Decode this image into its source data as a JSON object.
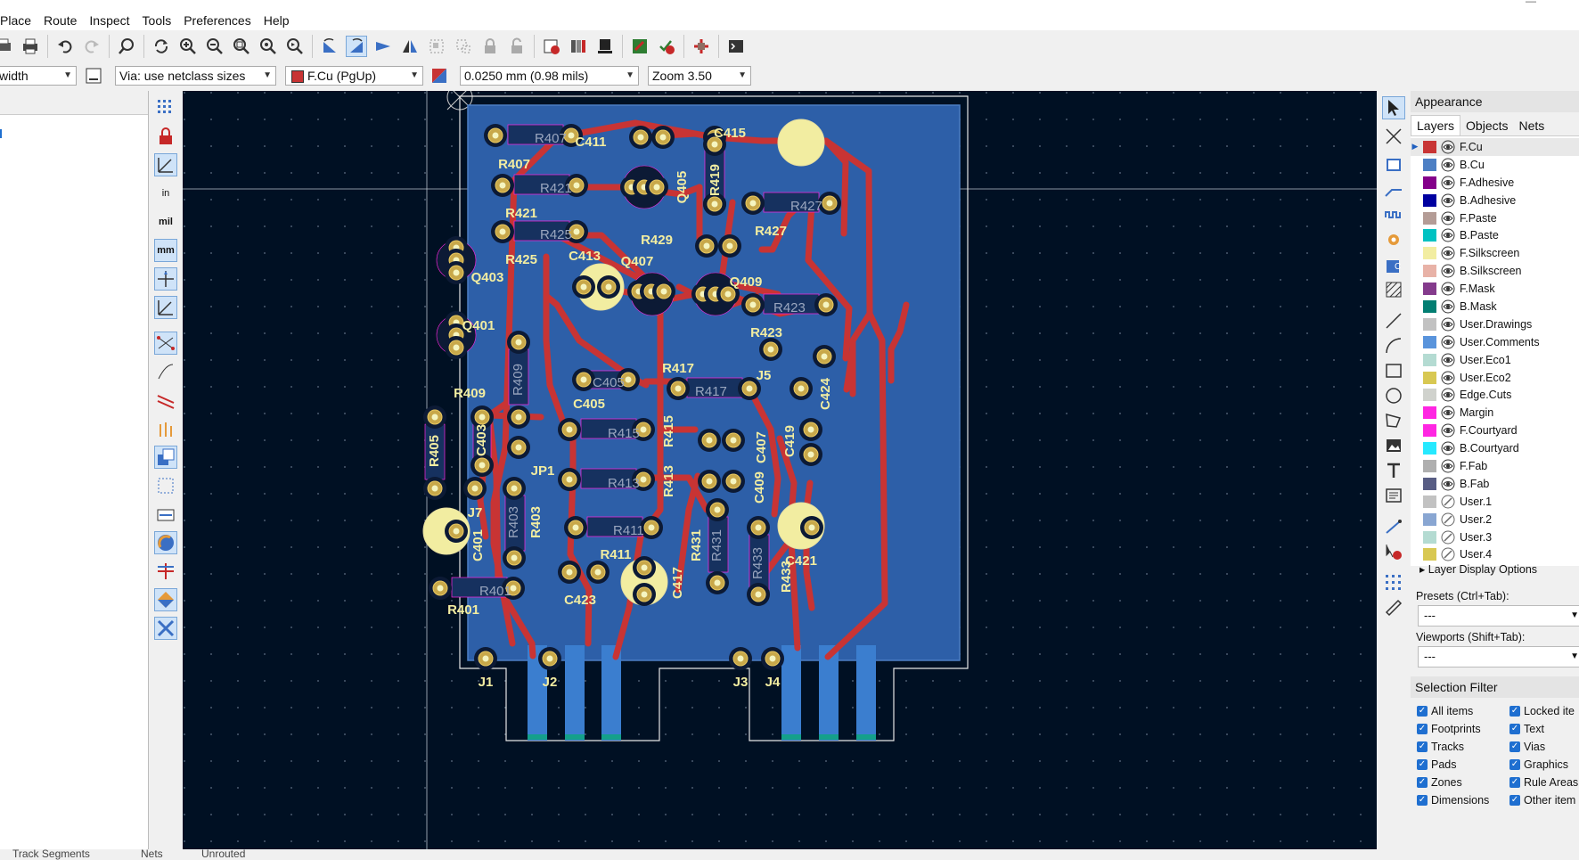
{
  "menu": [
    "Place",
    "Route",
    "Inspect",
    "Tools",
    "Preferences",
    "Help"
  ],
  "toolbar2": {
    "track_width": "width",
    "via_size": "Via: use netclass sizes",
    "layer": "F.Cu (PgUp)",
    "grid": "0.0250 mm (0.98 mils)",
    "zoom": "Zoom 3.50"
  },
  "units_buttons": {
    "inches": "in",
    "mils": "mil",
    "mm": "mm"
  },
  "appearance": {
    "title": "Appearance",
    "tabs": [
      "Layers",
      "Objects",
      "Nets"
    ],
    "layers": [
      {
        "name": "F.Cu",
        "color": "#c83434",
        "visible": true
      },
      {
        "name": "B.Cu",
        "color": "#4d7fc4",
        "visible": true
      },
      {
        "name": "F.Adhesive",
        "color": "#84008a",
        "visible": true
      },
      {
        "name": "B.Adhesive",
        "color": "#0000a0",
        "visible": true
      },
      {
        "name": "F.Paste",
        "color": "#b49c96",
        "visible": true
      },
      {
        "name": "B.Paste",
        "color": "#00c2c2",
        "visible": true
      },
      {
        "name": "F.Silkscreen",
        "color": "#f2eda1",
        "visible": true
      },
      {
        "name": "B.Silkscreen",
        "color": "#e8b2a7",
        "visible": true
      },
      {
        "name": "F.Mask",
        "color": "#843b8c",
        "visible": true
      },
      {
        "name": "B.Mask",
        "color": "#027e72",
        "visible": true
      },
      {
        "name": "User.Drawings",
        "color": "#c2c2c2",
        "visible": true
      },
      {
        "name": "User.Comments",
        "color": "#5994dc",
        "visible": true
      },
      {
        "name": "User.Eco1",
        "color": "#b4dbd2",
        "visible": true
      },
      {
        "name": "User.Eco2",
        "color": "#d8c852",
        "visible": true
      },
      {
        "name": "Edge.Cuts",
        "color": "#d0d2cd",
        "visible": true
      },
      {
        "name": "Margin",
        "color": "#ff26e2",
        "visible": true
      },
      {
        "name": "F.Courtyard",
        "color": "#ff26e2",
        "visible": true
      },
      {
        "name": "B.Courtyard",
        "color": "#26e9ff",
        "visible": true
      },
      {
        "name": "F.Fab",
        "color": "#afafaf",
        "visible": true
      },
      {
        "name": "B.Fab",
        "color": "#585d84",
        "visible": true
      },
      {
        "name": "User.1",
        "color": "#c2c2c2",
        "visible": false
      },
      {
        "name": "User.2",
        "color": "#89a6d2",
        "visible": false
      },
      {
        "name": "User.3",
        "color": "#b4dbd2",
        "visible": false
      },
      {
        "name": "User.4",
        "color": "#d8c852",
        "visible": false
      }
    ],
    "layer_display_options": "Layer Display Options",
    "presets_label": "Presets (Ctrl+Tab):",
    "presets_value": "---",
    "viewports_label": "Viewports (Shift+Tab):",
    "viewports_value": "---"
  },
  "selection_filter": {
    "title": "Selection Filter",
    "items": [
      {
        "label": "All items",
        "checked": true
      },
      {
        "label": "Locked ite",
        "checked": true
      },
      {
        "label": "Footprints",
        "checked": true
      },
      {
        "label": "Text",
        "checked": true
      },
      {
        "label": "Tracks",
        "checked": true
      },
      {
        "label": "Vias",
        "checked": true
      },
      {
        "label": "Pads",
        "checked": true
      },
      {
        "label": "Graphics",
        "checked": true
      },
      {
        "label": "Zones",
        "checked": true
      },
      {
        "label": "Rule Areas",
        "checked": true
      },
      {
        "label": "Dimensions",
        "checked": true
      },
      {
        "label": "Other item",
        "checked": true
      }
    ]
  },
  "statusbar": [
    "Track Segments",
    "Nets",
    "Unrouted"
  ],
  "pcb_labels": [
    {
      "ref": "R407",
      "fab": "R407"
    },
    {
      "ref": "C411"
    },
    {
      "ref": "C415"
    },
    {
      "ref": "R419",
      "fab": "R419"
    },
    {
      "ref": "R421",
      "fab": "R421"
    },
    {
      "ref": "Q405"
    },
    {
      "ref": "R427",
      "fab": "R427"
    },
    {
      "ref": "R425",
      "fab": "R425"
    },
    {
      "ref": "C413"
    },
    {
      "ref": "R429"
    },
    {
      "ref": "Q407"
    },
    {
      "ref": "Q403"
    },
    {
      "ref": "Q409"
    },
    {
      "ref": "R423",
      "fab": "R423"
    },
    {
      "ref": "Q401"
    },
    {
      "ref": "R409",
      "fab": "R409"
    },
    {
      "ref": "J5"
    },
    {
      "ref": "R417",
      "fab": "R417"
    },
    {
      "ref": "C405",
      "fab": "C405"
    },
    {
      "ref": "C424"
    },
    {
      "ref": "R405",
      "fab": "R405"
    },
    {
      "ref": "C403",
      "fab": "C403"
    },
    {
      "ref": "R415",
      "fab": "R415"
    },
    {
      "ref": "C407"
    },
    {
      "ref": "C419"
    },
    {
      "ref": "JP1"
    },
    {
      "ref": "R413",
      "fab": "R413"
    },
    {
      "ref": "C409"
    },
    {
      "ref": "J7"
    },
    {
      "ref": "R403",
      "fab": "R403"
    },
    {
      "ref": "R411",
      "fab": "R411"
    },
    {
      "ref": "R431",
      "fab": "R431"
    },
    {
      "ref": "C401"
    },
    {
      "ref": "C421"
    },
    {
      "ref": "R433",
      "fab": "R433"
    },
    {
      "ref": "C417"
    },
    {
      "ref": "R401",
      "fab": "R401"
    },
    {
      "ref": "C423"
    },
    {
      "ref": "J1"
    },
    {
      "ref": "J2"
    },
    {
      "ref": "J3"
    },
    {
      "ref": "J4"
    }
  ]
}
